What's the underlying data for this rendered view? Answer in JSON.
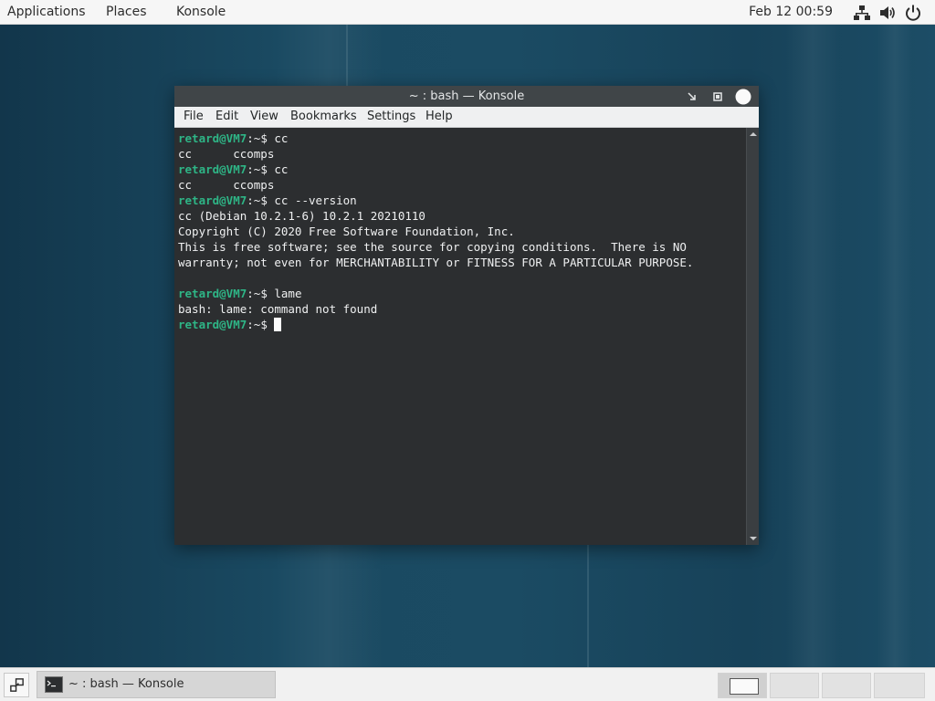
{
  "top_panel": {
    "applications": "Applications",
    "places": "Places",
    "konsole": "Konsole",
    "clock": "Feb 12  00:59",
    "tray_icons": [
      "network-icon",
      "volume-icon",
      "power-icon"
    ]
  },
  "window": {
    "title": "~ : bash — Konsole",
    "menu": [
      "File",
      "Edit",
      "View",
      "Bookmarks",
      "Settings",
      "Help"
    ]
  },
  "terminal": {
    "prompt": "retard@VM7",
    "prompt_suffix": ":~$ ",
    "lines": [
      {
        "prompt": true,
        "text": "cc"
      },
      {
        "prompt": false,
        "text": "cc      ccomps"
      },
      {
        "prompt": true,
        "text": "cc"
      },
      {
        "prompt": false,
        "text": "cc      ccomps"
      },
      {
        "prompt": true,
        "text": "cc --version"
      },
      {
        "prompt": false,
        "text": "cc (Debian 10.2.1-6) 10.2.1 20210110"
      },
      {
        "prompt": false,
        "text": "Copyright (C) 2020 Free Software Foundation, Inc."
      },
      {
        "prompt": false,
        "text": "This is free software; see the source for copying conditions.  There is NO"
      },
      {
        "prompt": false,
        "text": "warranty; not even for MERCHANTABILITY or FITNESS FOR A PARTICULAR PURPOSE."
      },
      {
        "prompt": false,
        "text": ""
      },
      {
        "prompt": true,
        "text": "lame"
      },
      {
        "prompt": false,
        "text": "bash: lame: command not found"
      },
      {
        "prompt": true,
        "text": "",
        "cursor": true
      }
    ],
    "prompt_color": "#2eb586",
    "background": "#2c2e30"
  },
  "bottom_panel": {
    "task_label": "~ : bash — Konsole",
    "workspaces": 4,
    "active_workspace": 1
  }
}
